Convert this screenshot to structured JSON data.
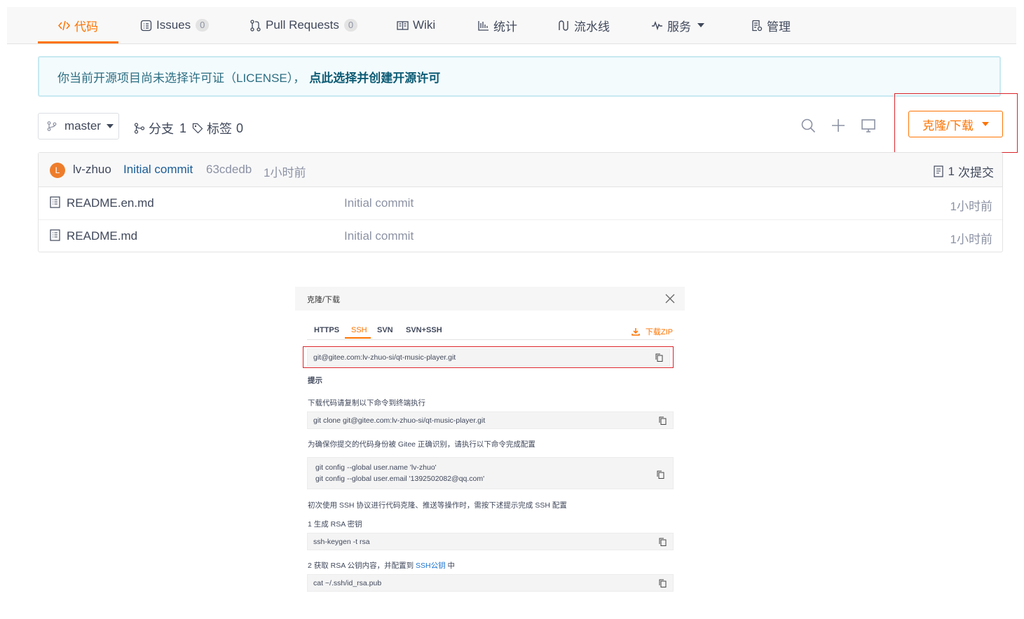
{
  "nav": {
    "tabs": [
      {
        "label": "代码",
        "icon": "code-icon",
        "active": true
      },
      {
        "label": "Issues",
        "icon": "issues-icon",
        "count": "0"
      },
      {
        "label": "Pull Requests",
        "icon": "pull-request-icon",
        "count": "0"
      },
      {
        "label": "Wiki",
        "icon": "wiki-icon"
      },
      {
        "label": "统计",
        "icon": "stats-icon"
      },
      {
        "label": "流水线",
        "icon": "pipeline-icon"
      },
      {
        "label": "服务",
        "icon": "service-icon"
      },
      {
        "label": "管理",
        "icon": "manage-icon"
      }
    ]
  },
  "notice": {
    "text": "你当前开源项目尚未选择许可证（LICENSE），",
    "link": "点此选择并创建开源许可"
  },
  "branch": {
    "current": "master",
    "branches_label": "分支",
    "branches_count": "1",
    "tags_label": "标签",
    "tags_count": "0"
  },
  "toolbar": {
    "clone_label": "克隆/下载"
  },
  "latest_commit": {
    "avatar_letter": "L",
    "author": "lv-zhuo",
    "message": "Initial commit",
    "hash": "63cdedb",
    "time": "1小时前",
    "commits_count": "1",
    "commits_label": "次提交"
  },
  "files": [
    {
      "name": "README.en.md",
      "message": "Initial commit",
      "time": "1小时前"
    },
    {
      "name": "README.md",
      "message": "Initial commit",
      "time": "1小时前"
    }
  ],
  "clone_panel": {
    "title": "克隆/下载",
    "tabs": [
      "HTTPS",
      "SSH",
      "SVN",
      "SVN+SSH"
    ],
    "active_tab": "SSH",
    "zip_label": "下载ZIP",
    "url": "git@gitee.com:lv-zhuo-si/qt-music-player.git",
    "tip_title": "提示",
    "tip_download": "下载代码请复制以下命令到终端执行",
    "clone_cmd": "git clone git@gitee.com:lv-zhuo-si/qt-music-player.git",
    "tip_config": "为确保你提交的代码身份被 Gitee 正确识别，请执行以下命令完成配置",
    "config_name": "git config --global user.name 'lv-zhuo'",
    "config_email": "git config --global user.email '1392502082@qq.com'",
    "tip_ssh": "初次使用 SSH 协议进行代码克隆、推送等操作时，需按下述提示完成 SSH 配置",
    "step1": "1 生成 RSA 密钥",
    "keygen_cmd": "ssh-keygen -t rsa",
    "step2_prefix": "2 获取 RSA 公钥内容，并配置到",
    "step2_link": "SSH公钥",
    "step2_suffix": "中",
    "cat_cmd": "cat ~/.ssh/id_rsa.pub"
  },
  "colors": {
    "accent": "#fe7300",
    "highlight_box": "#d9242a",
    "notice_bg": "#f3fbfd",
    "notice_link": "#0c5b74"
  }
}
